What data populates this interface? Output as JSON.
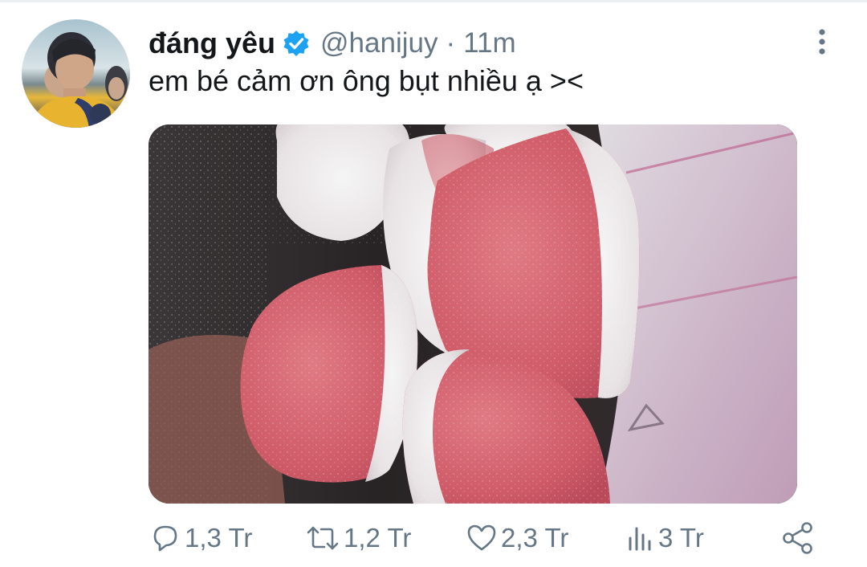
{
  "tweet": {
    "author": {
      "display_name": "đáng yêu",
      "handle": "@hanijuy",
      "verified": true,
      "avatar_icon": "avatar-photo"
    },
    "separator": "·",
    "timestamp": "11m",
    "text": "em bé cảm ơn ông bụt nhiều ạ ><",
    "media": {
      "kind": "photo",
      "subject": "sugar-coated gummy candies"
    },
    "actions": {
      "reply": {
        "icon": "reply-icon",
        "count": "1,3 Tr"
      },
      "retweet": {
        "icon": "retweet-icon",
        "count": "1,2 Tr"
      },
      "like": {
        "icon": "heart-icon",
        "count": "2,3 Tr"
      },
      "views": {
        "icon": "analytics-icon",
        "count": "3 Tr"
      },
      "share": {
        "icon": "share-icon"
      }
    },
    "menu_icon": "more-vertical-icon"
  },
  "colors": {
    "primary_text": "#14171a",
    "secondary_text": "#657786",
    "verified_blue": "#1da1f2"
  }
}
